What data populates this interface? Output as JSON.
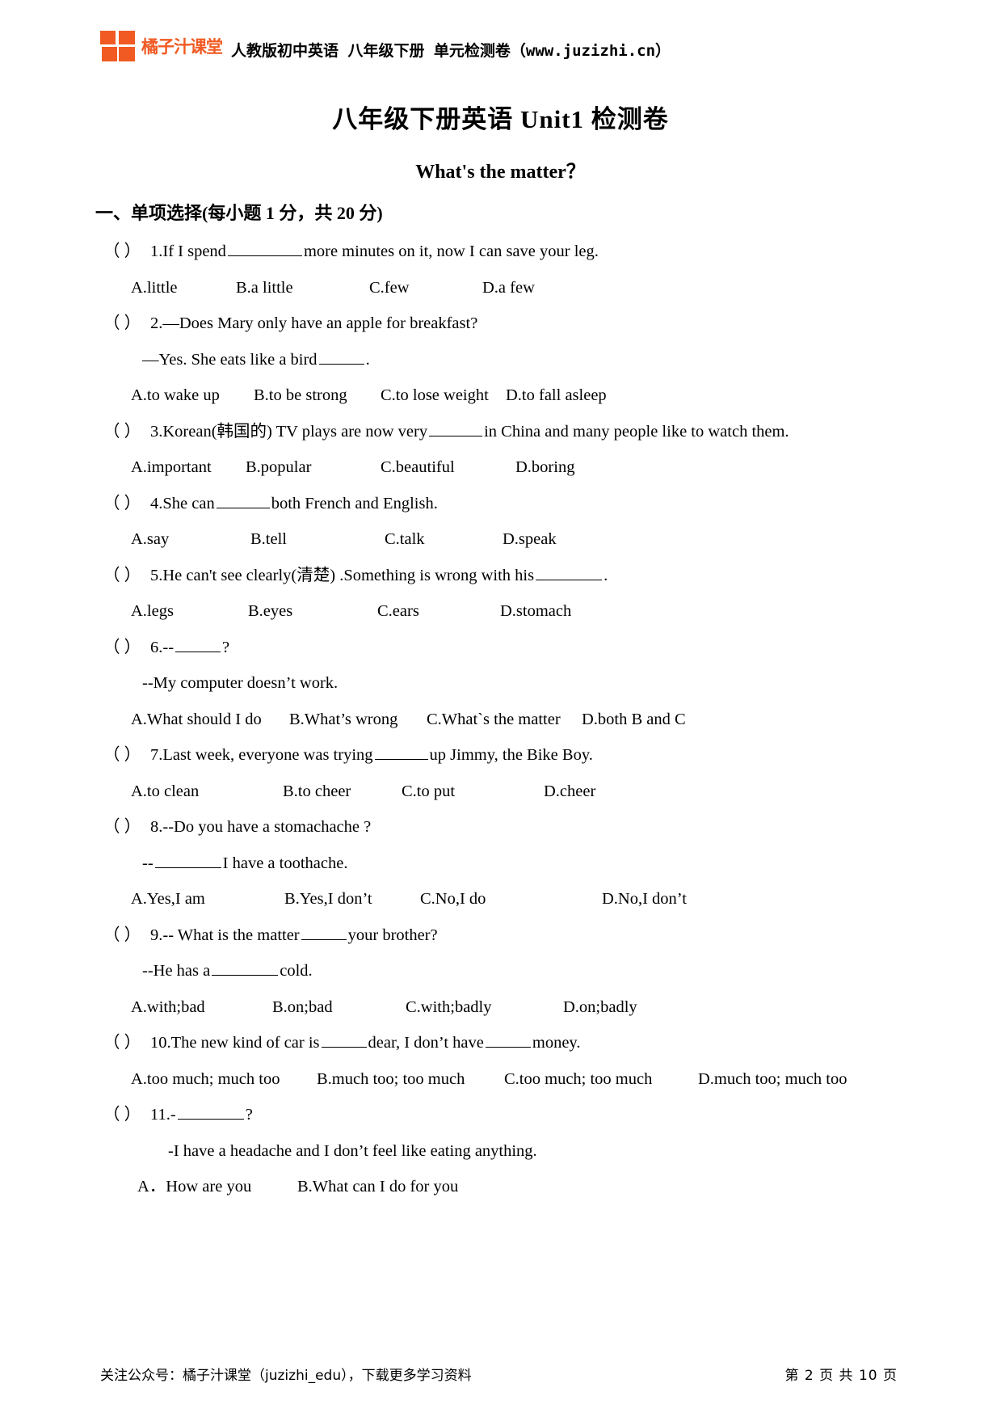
{
  "header": {
    "logo_text": "橘子汁课堂",
    "title": "人教版初中英语 八年级下册 单元检测卷（www.juzizhi.cn）",
    "brand_color": "#F15A22"
  },
  "doc": {
    "title": "八年级下册英语 Unit1 检测卷",
    "subtitle": "What's the matter？",
    "section_heading": "一、单项选择(每小题 1 分，共 20 分)"
  },
  "questions": [
    {
      "paren": "（     ）",
      "stem_before": "1.If I spend",
      "stem_after": "more minutes on it, now I can save your leg.",
      "options": [
        "A.little",
        "B.a little",
        "C.few",
        "D.a few"
      ]
    },
    {
      "paren": "（     ）",
      "stem_before": "2.—Does Mary only have an apple for breakfast?",
      "stem_after": "",
      "continuation_before": "—Yes. She eats like a bird",
      "continuation_after": ".",
      "options": [
        "A.to wake up",
        "B.to be strong",
        "C.to lose weight",
        "D.to fall asleep"
      ]
    },
    {
      "paren": "（     ）",
      "stem_before": "3.Korean(韩国的) TV plays are now very",
      "stem_after": "in China and many people like to watch them.",
      "options": [
        "A.important",
        "B.popular",
        "C.beautiful",
        "D.boring"
      ]
    },
    {
      "paren": "（     ）",
      "stem_before": "4.She can",
      "stem_after": "both French and English.",
      "options": [
        "A.say",
        "B.tell",
        "C.talk",
        "D.speak"
      ]
    },
    {
      "paren": "（     ）",
      "stem_before": "5.He can't see clearly(清楚) .Something is wrong with his",
      "stem_after": ".",
      "options": [
        "A.legs",
        "B.eyes",
        "C.ears",
        "D.stomach"
      ]
    },
    {
      "paren": "（     ）",
      "stem_before": "6.--",
      "stem_after": "?",
      "continuation_before": "--My computer doesn’t work.",
      "continuation_after": "",
      "options": [
        "A.What should I do",
        "B.What’s wrong",
        "C.What`s the matter",
        "D.both B and C"
      ]
    },
    {
      "paren": "（     ）",
      "stem_before": "7.Last week, everyone was trying",
      "stem_after": "up Jimmy, the Bike Boy.",
      "options": [
        "A.to clean",
        "B.to cheer",
        "C.to put",
        "D.cheer"
      ]
    },
    {
      "paren": "（     ）",
      "stem_before": "8.--Do you have a stomachache ?",
      "stem_after": "",
      "continuation_before": "--",
      "continuation_after": "I have a toothache.",
      "options": [
        "A.Yes,I am",
        "B.Yes,I don’t",
        "C.No,I do",
        "D.No,I don’t"
      ]
    },
    {
      "paren": "（     ）",
      "stem_before": "9.-- What is the matter",
      "stem_after": "your brother?",
      "continuation_before": "--He has a",
      "continuation_after": "cold.",
      "options": [
        "A.with;bad",
        "B.on;bad",
        "C.with;badly",
        "D.on;badly"
      ]
    },
    {
      "paren": "（     ）",
      "stem_before": "10.The new kind of car is",
      "stem_mid": "dear, I don’t have",
      "stem_after": "money.",
      "options": [
        "A.too much; much too",
        "B.much too; too much",
        "C.too much; too much",
        "D.much too; much too"
      ]
    },
    {
      "paren": "（     ）",
      "stem_before": "11.-",
      "stem_after": "?",
      "continuation_before": "-I have a headache and I don’t feel like eating anything.",
      "continuation_after": "",
      "options": [
        "A．How are you",
        "B.What can I do for you"
      ]
    }
  ],
  "footer": {
    "left": "关注公众号：橘子汁课堂（juzizhi_edu），下载更多学习资料",
    "right": "第 2 页 共 10 页"
  }
}
